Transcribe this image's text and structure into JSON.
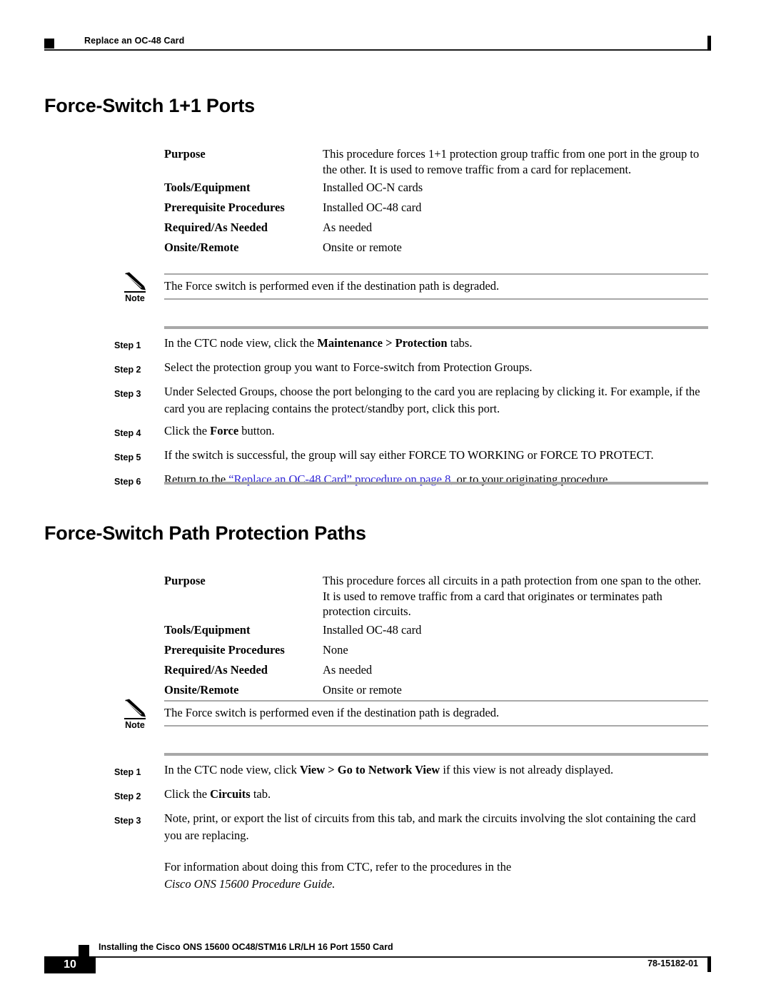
{
  "header": {
    "running_head": "Replace an OC-48 Card"
  },
  "sections": [
    {
      "heading": "Force-Switch 1+1 Ports",
      "properties": [
        {
          "label": "Purpose",
          "value": "This procedure forces 1+1 protection group traffic from one port in the group to the other. It is used to remove traffic from a card for replacement."
        },
        {
          "label": "Tools/Equipment",
          "value": "Installed OC-N cards"
        },
        {
          "label": "Prerequisite Procedures",
          "value": "Installed OC-48 card"
        },
        {
          "label": "Required/As Needed",
          "value": "As needed"
        },
        {
          "label": "Onsite/Remote",
          "value": "Onsite or remote"
        }
      ],
      "note": {
        "icon": "pencil-note-icon",
        "label": "Note",
        "text": "The Force switch is performed even if the destination path is degraded."
      },
      "steps": [
        {
          "num": "Step 1",
          "text_pre": "In the CTC node view, click the ",
          "bold": "Maintenance > Protection",
          "text_post": " tabs."
        },
        {
          "num": "Step 2",
          "text_pre": "Select the protection group you want to Force-switch from Protection Groups.",
          "bold": "",
          "text_post": ""
        },
        {
          "num": "Step 3",
          "text_pre": "Under Selected Groups, choose the port belonging to the card you are replacing by clicking it. For example, if the card you are replacing contains the protect/standby port, click this port.",
          "bold": "",
          "text_post": ""
        },
        {
          "num": "Step 4",
          "text_pre": "Click the ",
          "bold": "Force",
          "text_post": " button."
        },
        {
          "num": "Step 5",
          "text_pre": "If the switch is successful, the group will say either FORCE TO WORKING or FORCE TO PROTECT.",
          "bold": "",
          "text_post": ""
        },
        {
          "num": "Step 6",
          "text_pre": "Return to the ",
          "link": "“Replace an OC-48 Card” procedure on page 8",
          "text_post": ", or to your originating procedure."
        }
      ]
    },
    {
      "heading": "Force-Switch Path Protection Paths",
      "properties": [
        {
          "label": "Purpose",
          "value": "This procedure forces all circuits in a path protection from one span to the other. It is used to remove traffic from a card that originates or terminates path protection circuits."
        },
        {
          "label": "Tools/Equipment",
          "value": "Installed OC-48 card"
        },
        {
          "label": "Prerequisite Procedures",
          "value": "None"
        },
        {
          "label": "Required/As Needed",
          "value": "As needed"
        },
        {
          "label": "Onsite/Remote",
          "value": "Onsite or remote"
        }
      ],
      "note": {
        "icon": "pencil-note-icon",
        "label": "Note",
        "text": "The Force switch is performed even if the destination path is degraded."
      },
      "steps": [
        {
          "num": "Step 1",
          "text_pre": "In the CTC node view, click ",
          "bold": "View > Go to Network View",
          "text_post": " if this view is not already displayed."
        },
        {
          "num": "Step 2",
          "text_pre": "Click the ",
          "bold": "Circuits",
          "text_post": " tab."
        },
        {
          "num": "Step 3",
          "text_pre": "Note, print, or export the list of circuits from this tab, and mark the circuits involving the slot containing the card you are replacing.",
          "bold": "",
          "text_post": ""
        }
      ],
      "trailing_paragraph": "For information about doing this from CTC, refer to the procedures in the",
      "trailing_italic": "Cisco ONS 15600 Procedure Guide."
    }
  ],
  "footer": {
    "title": "Installing the Cisco ONS 15600 OC48/STM16 LR/LH 16 Port 1550 Card",
    "page_number": "10",
    "doc_number": "78-15182-01"
  },
  "colors": {
    "link": "#3026d6",
    "rule_grey": "#a8a8a8",
    "ink": "#000000"
  }
}
